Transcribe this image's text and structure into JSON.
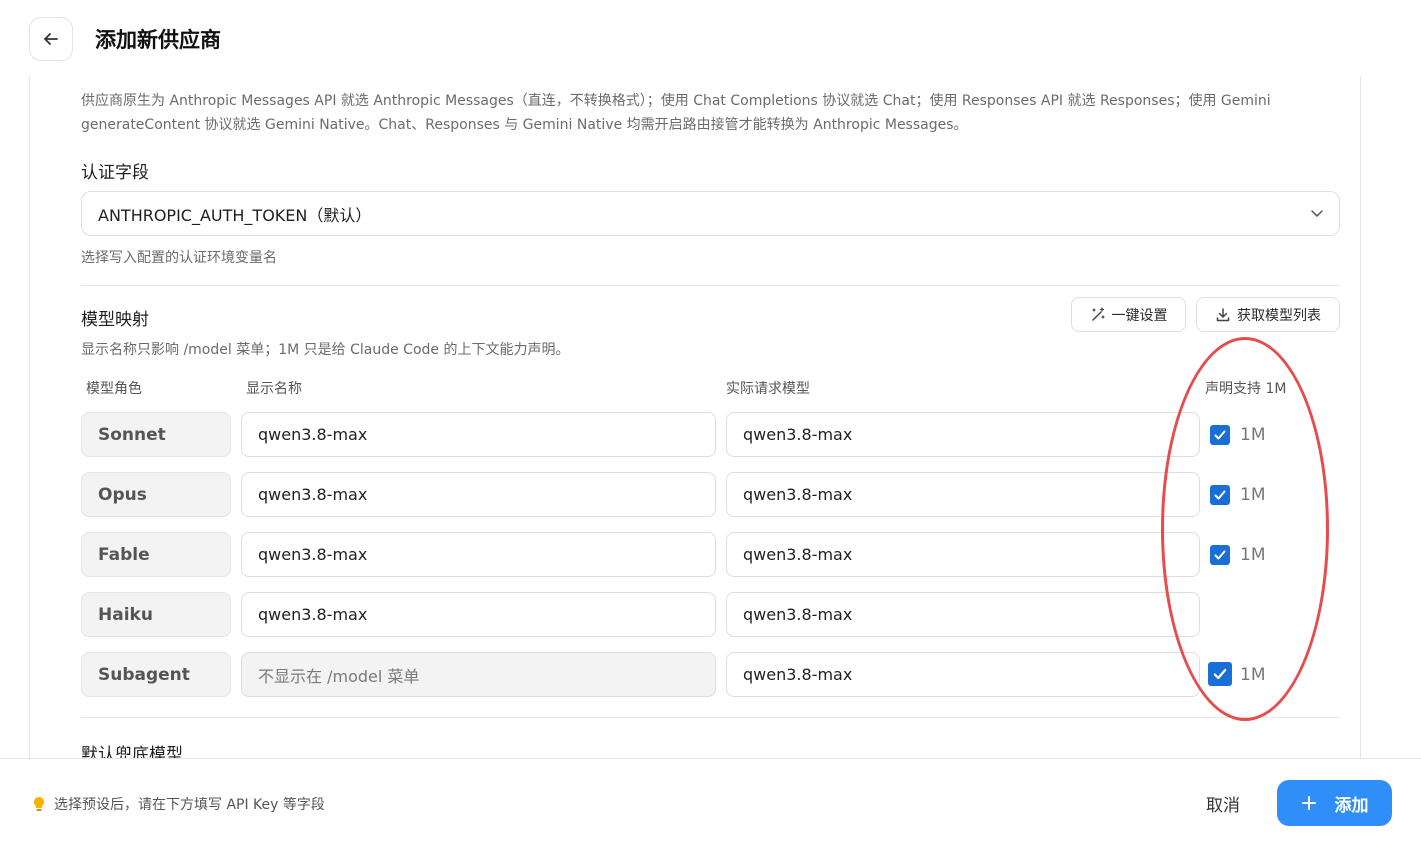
{
  "header": {
    "title": "添加新供应商"
  },
  "api_format": {
    "description": "供应商原生为 Anthropic Messages API 就选 Anthropic Messages（直连，不转换格式）；使用 Chat Completions 协议就选 Chat；使用 Responses API 就选 Responses；使用 Gemini generateContent 协议就选 Gemini Native。Chat、Responses 与 Gemini Native 均需开启路由接管才能转换为 Anthropic Messages。"
  },
  "auth_field": {
    "label": "认证字段",
    "selected": "ANTHROPIC_AUTH_TOKEN（默认）",
    "hint": "选择写入配置的认证环境变量名"
  },
  "model_mapping": {
    "label": "模型映射",
    "hint": "显示名称只影响 /model 菜单；1M 只是给 Claude Code 的上下文能力声明。",
    "one_click_label": "一键设置",
    "fetch_models_label": "获取模型列表",
    "columns": {
      "role": "模型角色",
      "display_name": "显示名称",
      "actual_model": "实际请求模型",
      "declare_1m": "声明支持 1M"
    },
    "rows": [
      {
        "role": "Sonnet",
        "display_name": "qwen3.8-max",
        "actual_model": "qwen3.8-max",
        "checked": true,
        "cb_label": "1M"
      },
      {
        "role": "Opus",
        "display_name": "qwen3.8-max",
        "actual_model": "qwen3.8-max",
        "checked": true,
        "cb_label": "1M"
      },
      {
        "role": "Fable",
        "display_name": "qwen3.8-max",
        "actual_model": "qwen3.8-max",
        "checked": true,
        "cb_label": "1M"
      },
      {
        "role": "Haiku",
        "display_name": "qwen3.8-max",
        "actual_model": "qwen3.8-max",
        "checked": false,
        "cb_label": ""
      },
      {
        "role": "Subagent",
        "display_name": "不显示在 /model 菜单",
        "actual_model": "qwen3.8-max",
        "checked": true,
        "cb_label": "1M"
      }
    ]
  },
  "fallback": {
    "label": "默认兜底模型"
  },
  "footer": {
    "hint": "选择预设后，请在下方填写 API Key 等字段",
    "cancel_label": "取消",
    "add_label": "添加"
  },
  "colors": {
    "accent": "#2f8ef7",
    "checkbox": "#1a6fd6",
    "annotation": "#e84b4b"
  }
}
